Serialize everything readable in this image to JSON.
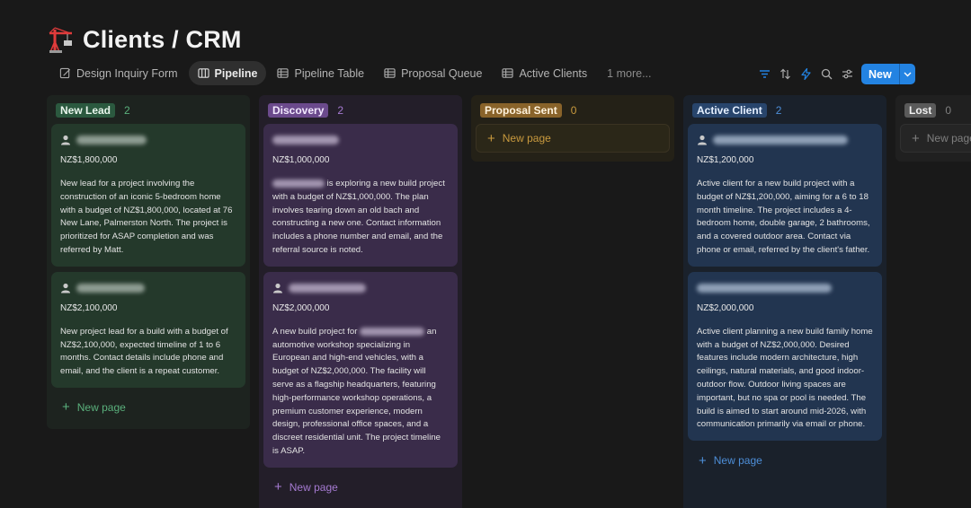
{
  "page": {
    "title": "Clients / CRM",
    "icon": "crane-icon"
  },
  "tabs": [
    {
      "label": "Design Inquiry Form",
      "icon": "form-icon"
    },
    {
      "label": "Pipeline",
      "icon": "board-icon"
    },
    {
      "label": "Pipeline Table",
      "icon": "table-icon"
    },
    {
      "label": "Proposal Queue",
      "icon": "table-icon"
    },
    {
      "label": "Active Clients",
      "icon": "table-icon"
    },
    {
      "label": "1 more..."
    }
  ],
  "toolbar": {
    "icons": [
      "filter-icon",
      "sort-icon",
      "automation-icon",
      "search-icon",
      "settings-icon"
    ],
    "new_label": "New"
  },
  "colors": {
    "accent": "#2383e2"
  },
  "board": {
    "new_page_label": "New page",
    "columns": [
      {
        "name": "New Lead",
        "count": "2",
        "badge_bg": "#2b593f",
        "badge_fg": "#e8f5ec",
        "count_color": "#5ab07c"
      },
      {
        "name": "Discovery",
        "count": "2",
        "badge_bg": "#6b4a8c",
        "badge_fg": "#f3eaff",
        "count_color": "#a57ad1"
      },
      {
        "name": "Proposal Sent",
        "count": "0",
        "badge_bg": "#89632a",
        "badge_fg": "#fff3dd",
        "count_color": "#c99a3e"
      },
      {
        "name": "Active Client",
        "count": "2",
        "badge_bg": "#28456c",
        "badge_fg": "#e5f0ff",
        "count_color": "#4d8ed8"
      },
      {
        "name": "Lost",
        "count": "0",
        "badge_bg": "#5a5a5a",
        "badge_fg": "#f0f0f0",
        "count_color": "#7f7f7f"
      }
    ],
    "cards": [
      {
        "price": "NZ$1,800,000",
        "desc": "New lead for a project involving the construction of an iconic 5-bedroom home with a budget of NZ$1,800,000, located at 76 New Lane, Palmerston North. The project is prioritized for ASAP completion and was referred by Matt."
      },
      {
        "price": "NZ$2,100,000",
        "desc": "New project lead for a build with a budget of NZ$2,100,000, expected timeline of 1 to 6 months. Contact details include phone and email, and the client is a repeat customer."
      },
      {
        "price": "NZ$1,000,000",
        "desc": "is exploring a new build project with a budget of NZ$1,000,000. The plan involves tearing down an old bach and constructing a new one. Contact information includes a phone number and email, and the referral source is noted."
      },
      {
        "price": "NZ$2,000,000",
        "desc_a": "A new build project for",
        "desc_b": "an automotive workshop specializing in European and high-end vehicles, with a budget of NZ$2,000,000. The facility will serve as a flagship headquarters, featuring high-performance workshop operations, a premium customer experience, modern design, professional office spaces, and a discreet residential unit. The project timeline is ASAP."
      },
      {
        "price": "NZ$1,200,000",
        "desc": "Active client for a new build project with a budget of NZ$1,200,000, aiming for a 6 to 18 month timeline. The project includes a 4-bedroom home, double garage, 2 bathrooms, and a covered outdoor area. Contact via phone or email, referred by the client's father."
      },
      {
        "price": "NZ$2,000,000",
        "desc": "Active client planning a new build family home with a budget of NZ$2,000,000. Desired features include modern architecture, high ceilings, natural materials, and good indoor-outdoor flow. Outdoor living spaces are important, but no spa or pool is needed. The build is aimed to start around mid-2026, with communication primarily via email or phone."
      }
    ]
  }
}
